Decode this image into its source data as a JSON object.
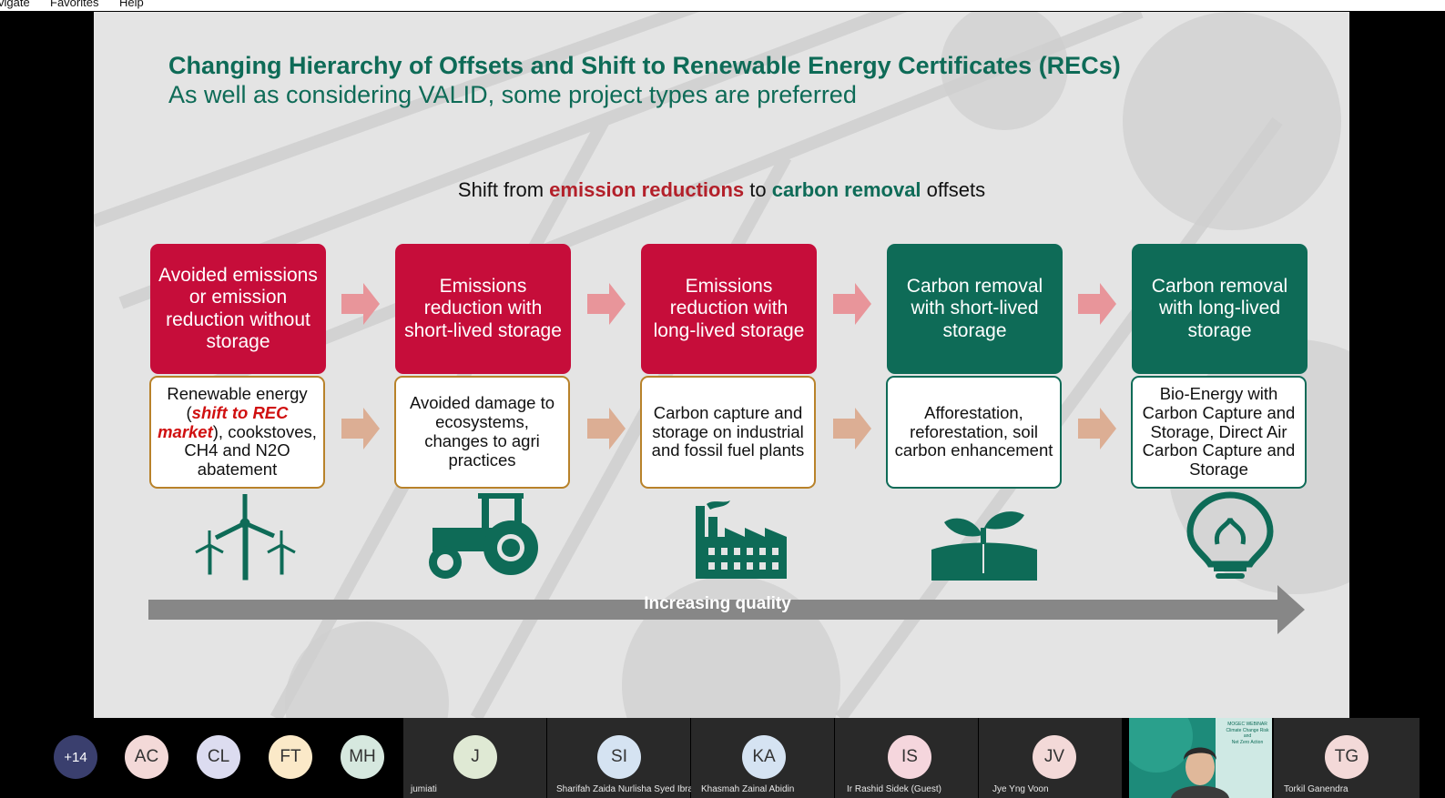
{
  "menu": {
    "items": [
      "vigate",
      "Favorites",
      "Help"
    ]
  },
  "slide": {
    "title": "Changing Hierarchy of Offsets and Shift to Renewable Energy Certificates (RECs)",
    "subtitle": "As well as considering VALID, some project types are preferred",
    "shift": {
      "prefix": "Shift from ",
      "red": "emission reductions",
      "middle": " to ",
      "green": "carbon removal",
      "suffix": " offsets"
    },
    "columns": [
      {
        "heading": "Avoided emissions or emission reduction without storage",
        "detail": "",
        "icon": "wind-turbines-icon",
        "heading_color": "#c60d3a"
      },
      {
        "heading": "Emissions reduction with short-lived storage",
        "detail": "Avoided damage to ecosystems, changes to agri practices",
        "icon": "tractor-icon",
        "heading_color": "#c60d3a"
      },
      {
        "heading": "Emissions reduction with long-lived storage",
        "detail": "Carbon capture and storage on industrial and fossil fuel plants",
        "icon": "factory-icon",
        "heading_color": "#c60d3a"
      },
      {
        "heading": "Carbon removal with short-lived storage",
        "detail": "Afforestation, reforestation, soil carbon enhancement",
        "icon": "seedling-icon",
        "heading_color": "#0e6b57"
      },
      {
        "heading": "Carbon removal with long-lived storage",
        "detail": "Bio-Energy with Carbon Capture and Storage, Direct Air Carbon Capture and Storage",
        "icon": "lightbulb-icon",
        "heading_color": "#0e6b57"
      }
    ],
    "col1_detail": {
      "a": "Renewable energy (",
      "em": "shift to REC market",
      "b": "), cookstoves, CH4 and N2O abatement"
    },
    "quality_label": "Increasing quality"
  },
  "participants": {
    "overflow": "+14",
    "avatars": [
      {
        "initials": "AC",
        "color": "#f3d9d8"
      },
      {
        "initials": "CL",
        "color": "#dcdcf0"
      },
      {
        "initials": "FT",
        "color": "#fbe9c8"
      },
      {
        "initials": "MH",
        "color": "#d6e8df"
      }
    ],
    "tiles": [
      {
        "initials": "J",
        "name": "jumiati",
        "color": "#dfe9d4"
      },
      {
        "initials": "SI",
        "name": "Sharifah Zaida Nurlisha Syed Ibrahim",
        "color": "#d5e3f2"
      },
      {
        "initials": "KA",
        "name": "Khasmah Zainal Abidin",
        "color": "#d5e3f2"
      },
      {
        "initials": "IS",
        "name": "Ir Rashid  Sidek (Guest)",
        "color": "#f5d6dd"
      },
      {
        "initials": "JV",
        "name": "Jye Yng Voon",
        "color": "#f3d9d8"
      },
      {
        "initials": "TG",
        "name": "Torkil Ganendra",
        "color": "#f3d9d8"
      }
    ],
    "video_text": [
      "MOGEC WEBINAR",
      "Climate Change Risk",
      "and",
      "Net Zero Action"
    ]
  }
}
